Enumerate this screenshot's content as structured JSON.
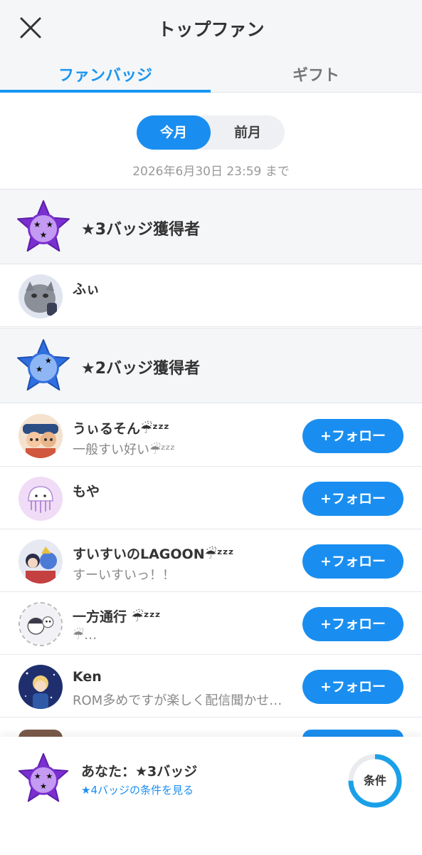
{
  "header": {
    "title": "トップファン",
    "close_icon": "close-icon"
  },
  "tabs": [
    {
      "label": "ファンバッジ",
      "active": true
    },
    {
      "label": "ギフト",
      "active": false
    }
  ],
  "period": {
    "current": "今月",
    "previous": "前月",
    "selected": "今月"
  },
  "deadline": "2026年6月30日 23:59 まで",
  "colors": {
    "accent": "#1a8ef0",
    "badge3": "#8a3fd8",
    "badge2": "#2f6fe0"
  },
  "sections": [
    {
      "label": "★3バッジ獲得者",
      "badge_icon": "star-badge-purple-icon",
      "fans": [
        {
          "name": "ふぃ",
          "sub": "",
          "follow": false,
          "avatar_icon": "cat-avatar"
        }
      ]
    },
    {
      "label": "★2バッジ獲得者",
      "badge_icon": "star-badge-blue-icon",
      "fans": [
        {
          "name": "うぃるそん☔︎ᶻᶻᶻ",
          "sub": "一般すい好い☔︎ᶻᶻᶻ",
          "follow": true,
          "avatar_icon": "character-avatar"
        },
        {
          "name": "もや",
          "sub": "",
          "follow": true,
          "avatar_icon": "jellyfish-avatar"
        },
        {
          "name": "すいすいのLAGOON☔︎ᶻᶻᶻ",
          "sub": "すーいすいっ！！",
          "follow": true,
          "avatar_icon": "anime-avatar"
        },
        {
          "name": "一方通行 ☔︎ᶻᶻᶻ",
          "sub": "☔︎…",
          "follow": true,
          "avatar_icon": "sketch-avatar"
        },
        {
          "name": "Ken",
          "sub": "ROM多めですが楽しく配信聞かせ…",
          "follow": true,
          "avatar_icon": "night-avatar"
        }
      ]
    }
  ],
  "follow_label": "+フォロー",
  "footer": {
    "you_label": "あなた：★3バッジ",
    "link_label": "★4バッジの条件を見る",
    "condition_label": "条件",
    "progress": 0.75
  }
}
